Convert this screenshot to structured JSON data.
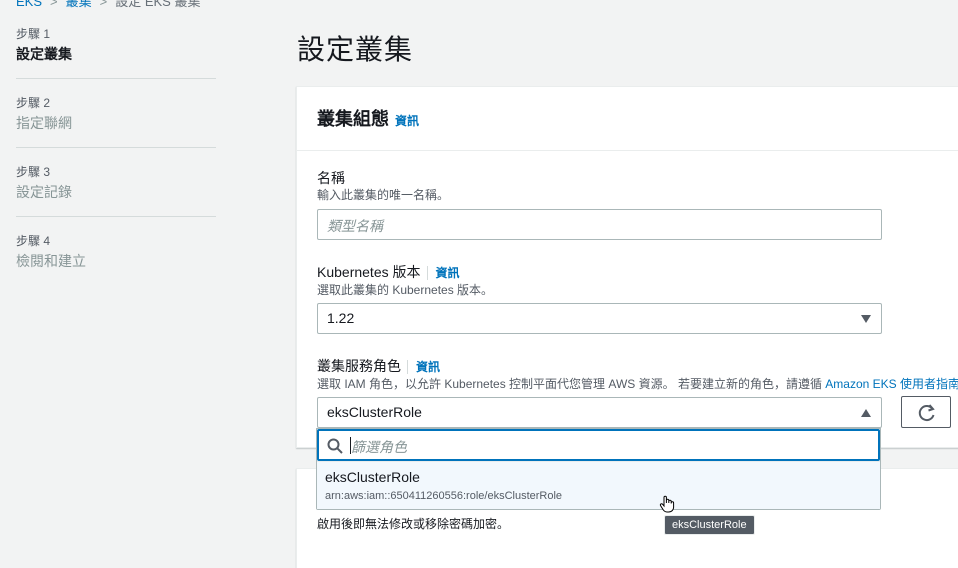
{
  "breadcrumb": {
    "items": [
      "EKS",
      "叢集",
      "設定 EKS 叢集"
    ]
  },
  "steps": [
    {
      "num": "步驟 1",
      "title": "設定叢集"
    },
    {
      "num": "步驟 2",
      "title": "指定聯網"
    },
    {
      "num": "步驟 3",
      "title": "設定記錄"
    },
    {
      "num": "步驟 4",
      "title": "檢閱和建立"
    }
  ],
  "page": {
    "title": "設定叢集"
  },
  "panel": {
    "title": "叢集組態",
    "info": "資訊",
    "name": {
      "label": "名稱",
      "desc": "輸入此叢集的唯一名稱。",
      "placeholder": "類型名稱"
    },
    "k8s": {
      "label": "Kubernetes 版本",
      "info": "資訊",
      "desc": "選取此叢集的 Kubernetes 版本。",
      "value": "1.22"
    },
    "role": {
      "label": "叢集服務角色",
      "info": "資訊",
      "desc": "選取 IAM 角色，以允許 Kubernetes 控制平面代您管理 AWS 資源。 若要建立新的角色，請遵循",
      "desc_link": "Amazon EKS 使用者指南",
      "value": "eksClusterRole"
    }
  },
  "dropdown": {
    "filter_placeholder": "篩選角色",
    "options": [
      {
        "name": "eksClusterRole",
        "arn": "arn:aws:iam::650411260556:role/eksClusterRole"
      }
    ]
  },
  "panel2": {
    "note": "啟用後即無法修改或移除密碼加密。"
  },
  "tooltip": "eksClusterRole",
  "icons": {
    "search": "search-icon",
    "refresh": "refresh-icon",
    "caret": "caret-icon",
    "cursor": "hand-cursor-icon"
  }
}
